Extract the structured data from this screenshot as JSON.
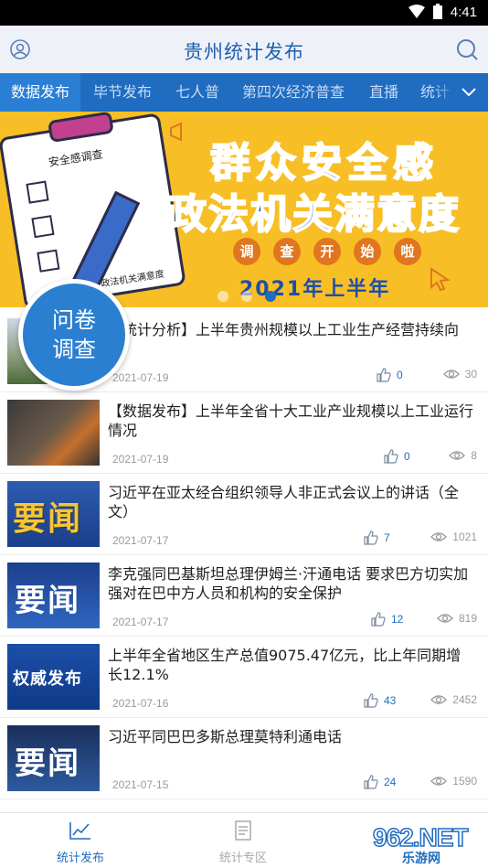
{
  "status_bar": {
    "time": "4:41"
  },
  "header": {
    "title": "贵州统计发布"
  },
  "tabs": [
    {
      "label": "数据发布",
      "active": true
    },
    {
      "label": "毕节发布"
    },
    {
      "label": "七人普"
    },
    {
      "label": "第四次经济普查"
    },
    {
      "label": "直播"
    },
    {
      "label": "统计"
    }
  ],
  "banner": {
    "clipboard_title": "安全感调查",
    "clipboard_footer": "政法机关满意度",
    "headline_line1": "群众安全感",
    "headline_line2": "政法机关满意度",
    "pills": [
      "调",
      "查",
      "开",
      "始",
      "啦"
    ],
    "subline": "2021年上半年",
    "page_count": 3,
    "active_page": 3
  },
  "floating_badge": {
    "line1": "问卷",
    "line2": "调查"
  },
  "news": [
    {
      "title": "【统计分析】上半年贵州规模以上工业生产经营持续向",
      "date": "2021-07-19",
      "likes": "0",
      "views": "30",
      "thumb": "city"
    },
    {
      "title": "【数据发布】上半年全省十大工业产业规模以上工业运行情况",
      "date": "2021-07-19",
      "likes": "0",
      "views": "8",
      "thumb": "factory"
    },
    {
      "title": "习近平在亚太经合组织领导人非正式会议上的讲话（全文）",
      "date": "2021-07-17",
      "likes": "7",
      "views": "1021",
      "thumb": "yaowen",
      "thumb_text": "要闻"
    },
    {
      "title": "李克强同巴基斯坦总理伊姆兰·汗通电话 要求巴方切实加强对在巴中方人员和机构的安全保护",
      "date": "2021-07-17",
      "likes": "12",
      "views": "819",
      "thumb": "yaowen2",
      "thumb_text": "要闻"
    },
    {
      "title": "上半年全省地区生产总值9075.47亿元，比上年同期增长12.1%",
      "date": "2021-07-16",
      "likes": "43",
      "views": "2452",
      "thumb": "quanwei",
      "thumb_text": "权威发布"
    },
    {
      "title": "习近平同巴巴多斯总理莫特利通电话",
      "date": "2021-07-15",
      "likes": "24",
      "views": "1590",
      "thumb": "yaowen3",
      "thumb_text": "要闻"
    }
  ],
  "bottom_nav": [
    {
      "label": "统计发布",
      "active": true
    },
    {
      "label": "统计专区"
    }
  ],
  "watermark": {
    "number": "962.NET",
    "sub": "乐游网"
  },
  "colors": {
    "brand_blue": "#1f6cc1",
    "banner_yellow": "#f7bf25",
    "title_blue": "#1f5fae"
  }
}
